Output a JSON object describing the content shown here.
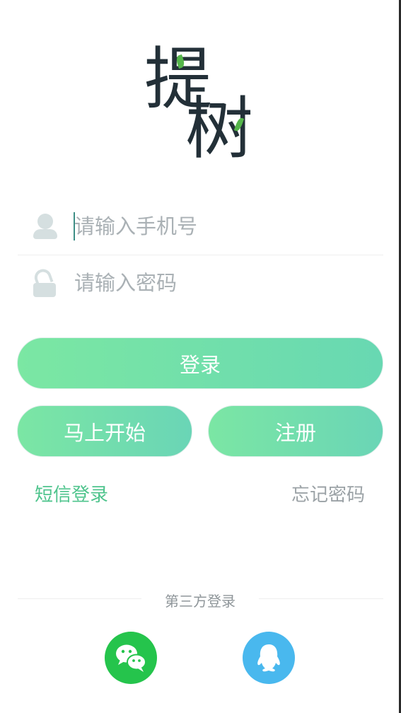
{
  "logo": {
    "char1": "提",
    "char2": "树"
  },
  "login_form": {
    "phone_placeholder": "请输入手机号",
    "password_placeholder": "请输入密码",
    "login_button": "登录",
    "start_button": "马上开始",
    "register_button": "注册",
    "sms_login_link": "短信登录",
    "forgot_password_link": "忘记密码"
  },
  "third_party": {
    "label": "第三方登录",
    "options": [
      {
        "icon": "wechat-icon",
        "color": "#25c44c"
      },
      {
        "icon": "qq-icon",
        "color": "#49b8ee"
      }
    ]
  },
  "colors": {
    "accent_green": "#4fc48d",
    "button_gradient_start": "#7be7a3",
    "button_gradient_end": "#68d8b2"
  }
}
